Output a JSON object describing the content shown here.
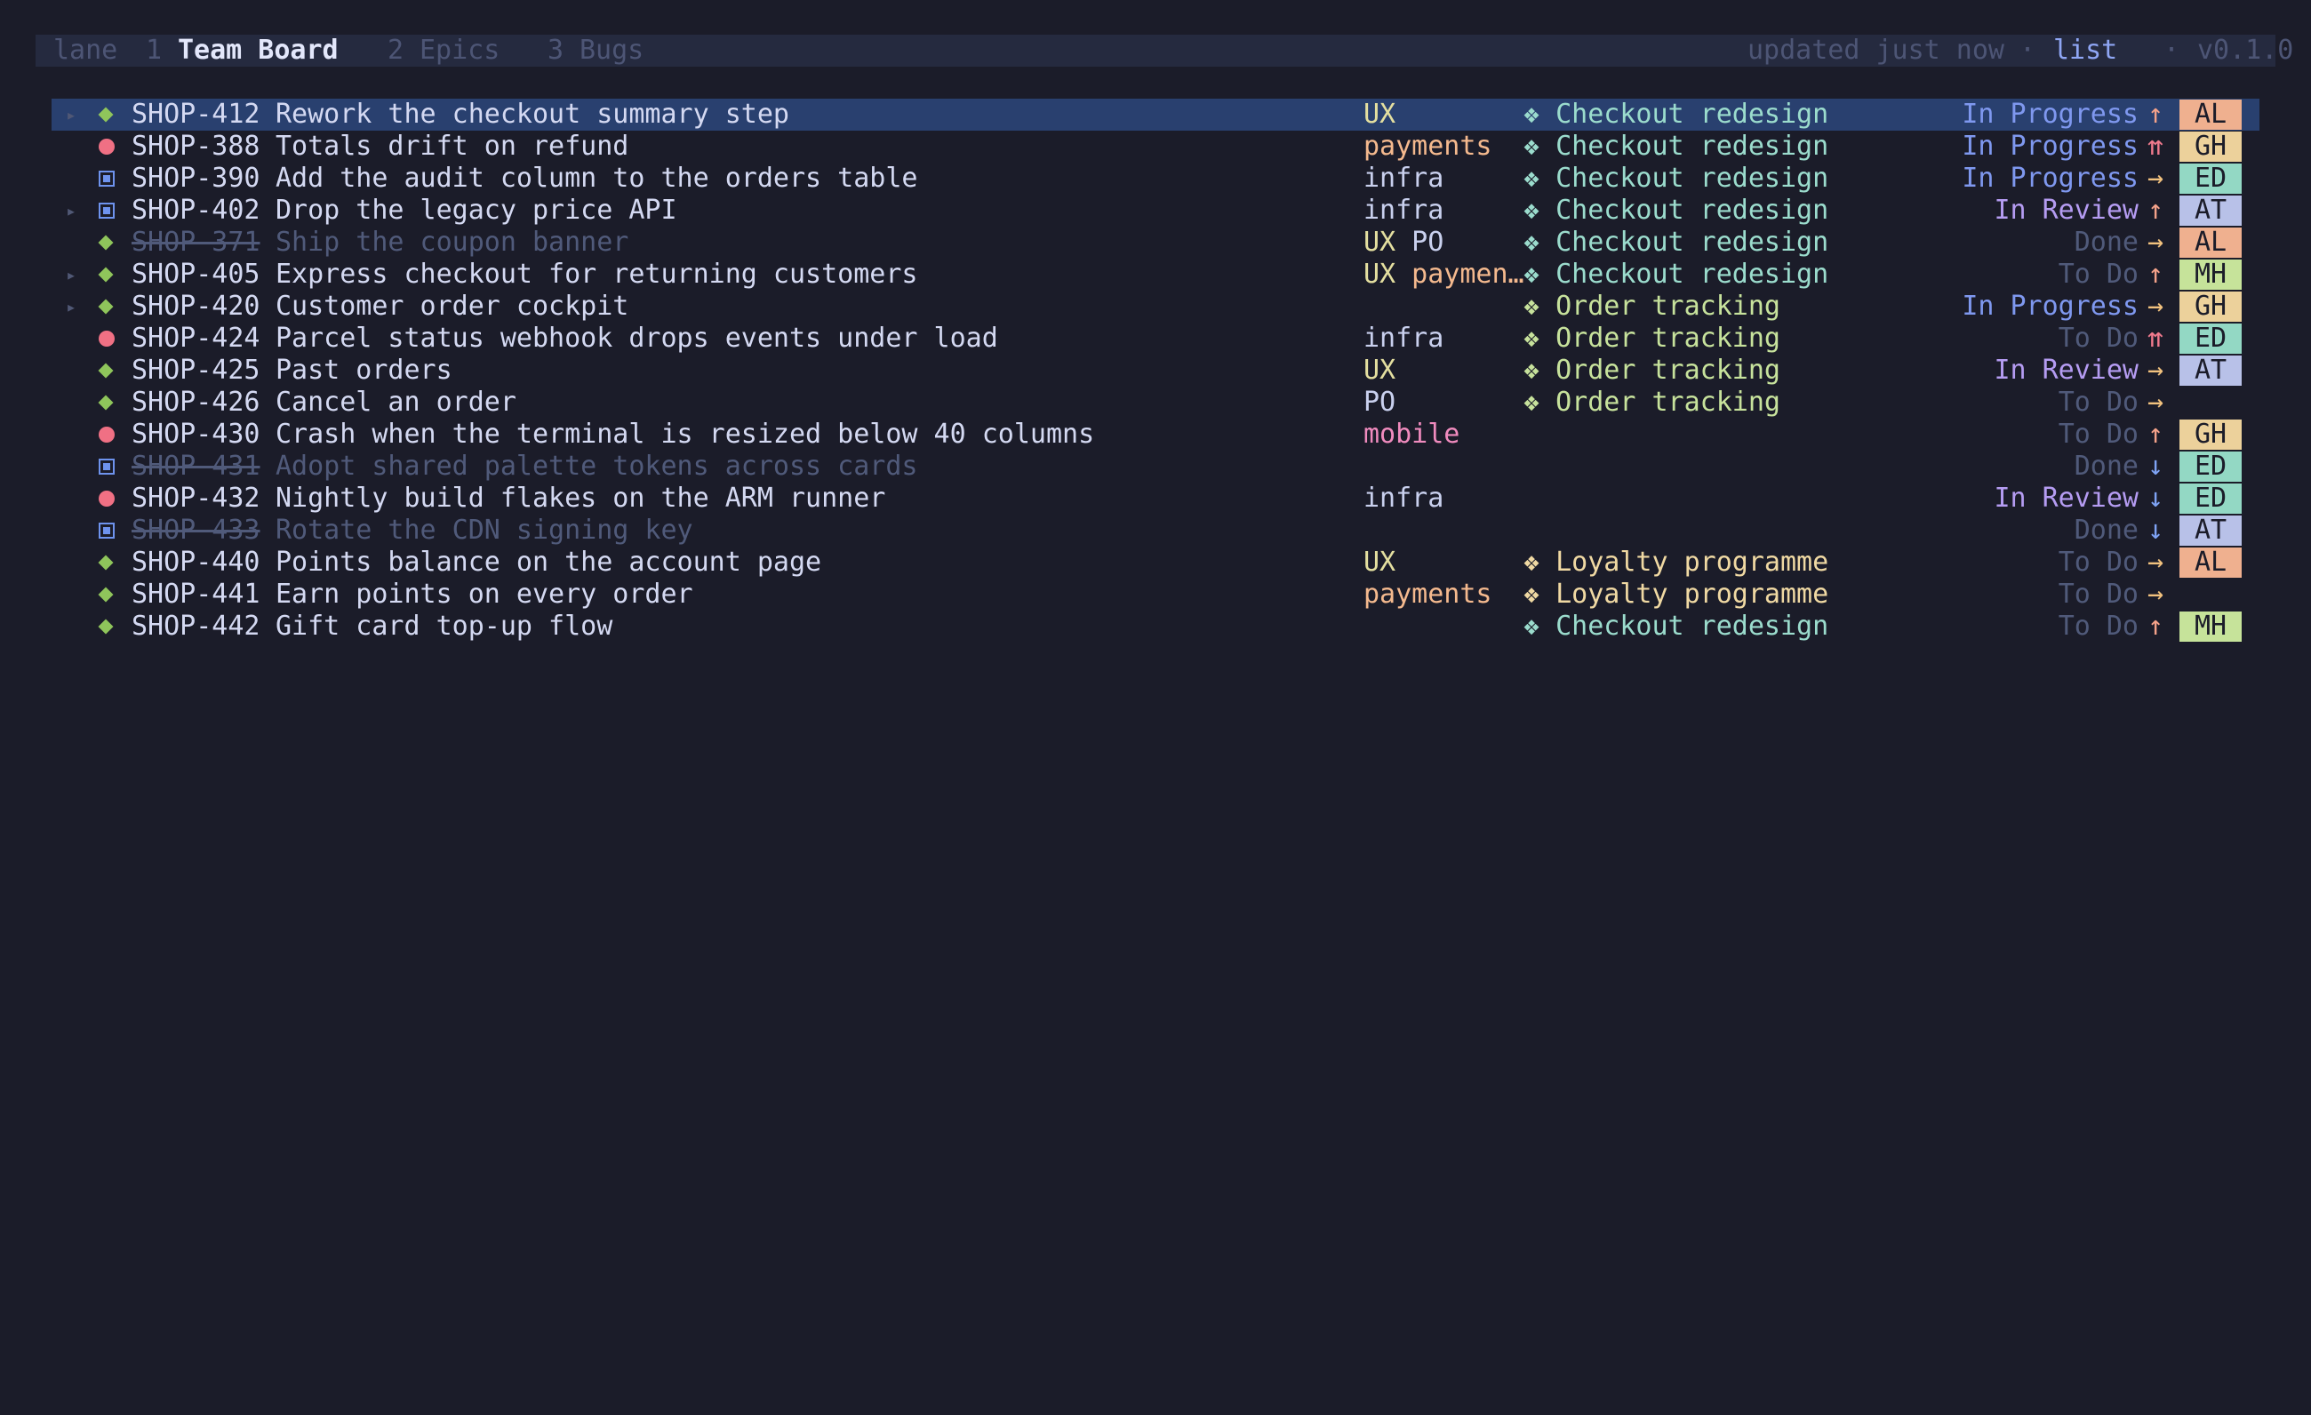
{
  "topbar": {
    "app_name": "lane",
    "tabs": [
      {
        "num": "1",
        "label": "Team Board",
        "active": true
      },
      {
        "num": "2",
        "label": "Epics",
        "active": false
      },
      {
        "num": "3",
        "label": "Bugs",
        "active": false
      }
    ],
    "updated": "updated just now",
    "sep1": "·",
    "view_mode": "list",
    "sep2": "·",
    "version": "v0.1.0"
  },
  "colors": {
    "background": "#1b1c29",
    "selected_row": "#29406f",
    "avatar_AL": "#efb08f",
    "avatar_GH": "#ecd19b",
    "avatar_ED": "#93d8c4",
    "avatar_AT": "#b8c1e8",
    "avatar_MH": "#c6e39a"
  },
  "rows": [
    {
      "expander": "▸",
      "type": "story",
      "type_icon": "story-diamond-icon",
      "key": "SHOP-412",
      "title": "Rework the checkout summary step",
      "labels": [
        {
          "text": "UX",
          "kind": "UX"
        }
      ],
      "epic_glyph": "❖",
      "epic": "Checkout redesign",
      "epic_color": "teal",
      "status": "In Progress",
      "status_kind": "progress",
      "priority": "↑",
      "priority_kind": "high",
      "assignee": "AL",
      "selected": true,
      "done": false
    },
    {
      "expander": "",
      "type": "bug",
      "type_icon": "bug-dot-icon",
      "key": "SHOP-388",
      "title": "Totals drift on refund",
      "labels": [
        {
          "text": "payments",
          "kind": "payments"
        }
      ],
      "epic_glyph": "❖",
      "epic": "Checkout redesign",
      "epic_color": "teal",
      "status": "In Progress",
      "status_kind": "progress",
      "priority": "⇈",
      "priority_kind": "highest",
      "assignee": "GH",
      "selected": false,
      "done": false
    },
    {
      "expander": "",
      "type": "task",
      "type_icon": "task-square-icon",
      "key": "SHOP-390",
      "title": "Add the audit column to the orders table",
      "labels": [
        {
          "text": "infra",
          "kind": "infra"
        }
      ],
      "epic_glyph": "❖",
      "epic": "Checkout redesign",
      "epic_color": "teal",
      "status": "In Progress",
      "status_kind": "progress",
      "priority": "→",
      "priority_kind": "medium",
      "assignee": "ED",
      "selected": false,
      "done": false
    },
    {
      "expander": "▸",
      "type": "task",
      "type_icon": "task-square-icon",
      "key": "SHOP-402",
      "title": "Drop the legacy price API",
      "labels": [
        {
          "text": "infra",
          "kind": "infra"
        }
      ],
      "epic_glyph": "❖",
      "epic": "Checkout redesign",
      "epic_color": "teal",
      "status": "In Review",
      "status_kind": "review",
      "priority": "↑",
      "priority_kind": "high",
      "assignee": "AT",
      "selected": false,
      "done": false
    },
    {
      "expander": "",
      "type": "story",
      "type_icon": "story-diamond-icon",
      "key": "SHOP-371",
      "title": "Ship the coupon banner",
      "labels": [
        {
          "text": "UX",
          "kind": "UX"
        },
        {
          "text": "PO",
          "kind": "PO"
        }
      ],
      "epic_glyph": "❖",
      "epic": "Checkout redesign",
      "epic_color": "teal",
      "status": "Done",
      "status_kind": "done",
      "priority": "→",
      "priority_kind": "medium",
      "assignee": "AL",
      "selected": false,
      "done": true
    },
    {
      "expander": "▸",
      "type": "story",
      "type_icon": "story-diamond-icon",
      "key": "SHOP-405",
      "title": "Express checkout for returning customers",
      "labels": [
        {
          "text": "UX",
          "kind": "UX"
        },
        {
          "text": "paymen…",
          "kind": "payments"
        }
      ],
      "epic_glyph": "❖",
      "epic": "Checkout redesign",
      "epic_color": "teal",
      "status": "To Do",
      "status_kind": "todo",
      "priority": "↑",
      "priority_kind": "high",
      "assignee": "MH",
      "selected": false,
      "done": false
    },
    {
      "expander": "▸",
      "type": "story",
      "type_icon": "story-diamond-icon",
      "key": "SHOP-420",
      "title": "Customer order cockpit",
      "labels": [],
      "epic_glyph": "❖",
      "epic": "Order tracking",
      "epic_color": "green",
      "status": "In Progress",
      "status_kind": "progress",
      "priority": "→",
      "priority_kind": "medium",
      "assignee": "GH",
      "selected": false,
      "done": false
    },
    {
      "expander": "",
      "type": "bug",
      "type_icon": "bug-dot-icon",
      "key": "SHOP-424",
      "title": "Parcel status webhook drops events under load",
      "labels": [
        {
          "text": "infra",
          "kind": "infra"
        }
      ],
      "epic_glyph": "❖",
      "epic": "Order tracking",
      "epic_color": "green",
      "status": "To Do",
      "status_kind": "todo",
      "priority": "⇈",
      "priority_kind": "highest",
      "assignee": "ED",
      "selected": false,
      "done": false
    },
    {
      "expander": "",
      "type": "story",
      "type_icon": "story-diamond-icon",
      "key": "SHOP-425",
      "title": "Past orders",
      "labels": [
        {
          "text": "UX",
          "kind": "UX"
        }
      ],
      "epic_glyph": "❖",
      "epic": "Order tracking",
      "epic_color": "green",
      "status": "In Review",
      "status_kind": "review",
      "priority": "→",
      "priority_kind": "medium",
      "assignee": "AT",
      "selected": false,
      "done": false
    },
    {
      "expander": "",
      "type": "story",
      "type_icon": "story-diamond-icon",
      "key": "SHOP-426",
      "title": "Cancel an order",
      "labels": [
        {
          "text": "PO",
          "kind": "PO"
        }
      ],
      "epic_glyph": "❖",
      "epic": "Order tracking",
      "epic_color": "green",
      "status": "To Do",
      "status_kind": "todo",
      "priority": "→",
      "priority_kind": "medium",
      "assignee": "",
      "selected": false,
      "done": false
    },
    {
      "expander": "",
      "type": "bug",
      "type_icon": "bug-dot-icon",
      "key": "SHOP-430",
      "title": "Crash when the terminal is resized below 40 columns",
      "labels": [
        {
          "text": "mobile",
          "kind": "mobile"
        }
      ],
      "epic_glyph": "",
      "epic": "",
      "epic_color": "teal",
      "status": "To Do",
      "status_kind": "todo",
      "priority": "↑",
      "priority_kind": "high",
      "assignee": "GH",
      "selected": false,
      "done": false
    },
    {
      "expander": "",
      "type": "task",
      "type_icon": "task-square-icon",
      "key": "SHOP-431",
      "title": "Adopt shared palette tokens across cards",
      "labels": [],
      "epic_glyph": "",
      "epic": "",
      "epic_color": "teal",
      "status": "Done",
      "status_kind": "done",
      "priority": "↓",
      "priority_kind": "low",
      "assignee": "ED",
      "selected": false,
      "done": true
    },
    {
      "expander": "",
      "type": "bug",
      "type_icon": "bug-dot-icon",
      "key": "SHOP-432",
      "title": "Nightly build flakes on the ARM runner",
      "labels": [
        {
          "text": "infra",
          "kind": "infra"
        }
      ],
      "epic_glyph": "",
      "epic": "",
      "epic_color": "teal",
      "status": "In Review",
      "status_kind": "review",
      "priority": "↓",
      "priority_kind": "low",
      "assignee": "ED",
      "selected": false,
      "done": false
    },
    {
      "expander": "",
      "type": "task",
      "type_icon": "task-square-icon",
      "key": "SHOP-433",
      "title": "Rotate the CDN signing key",
      "labels": [],
      "epic_glyph": "",
      "epic": "",
      "epic_color": "teal",
      "status": "Done",
      "status_kind": "done",
      "priority": "↓",
      "priority_kind": "low",
      "assignee": "AT",
      "selected": false,
      "done": true
    },
    {
      "expander": "",
      "type": "story",
      "type_icon": "story-diamond-icon",
      "key": "SHOP-440",
      "title": "Points balance on the account page",
      "labels": [
        {
          "text": "UX",
          "kind": "UX"
        }
      ],
      "epic_glyph": "❖",
      "epic": "Loyalty programme",
      "epic_color": "gold",
      "status": "To Do",
      "status_kind": "todo",
      "priority": "→",
      "priority_kind": "medium",
      "assignee": "AL",
      "selected": false,
      "done": false
    },
    {
      "expander": "",
      "type": "story",
      "type_icon": "story-diamond-icon",
      "key": "SHOP-441",
      "title": "Earn points on every order",
      "labels": [
        {
          "text": "payments",
          "kind": "payments"
        }
      ],
      "epic_glyph": "❖",
      "epic": "Loyalty programme",
      "epic_color": "gold",
      "status": "To Do",
      "status_kind": "todo",
      "priority": "→",
      "priority_kind": "medium",
      "assignee": "",
      "selected": false,
      "done": false
    },
    {
      "expander": "",
      "type": "story",
      "type_icon": "story-diamond-icon",
      "key": "SHOP-442",
      "title": "Gift card top-up flow",
      "labels": [],
      "epic_glyph": "❖",
      "epic": "Checkout redesign",
      "epic_color": "teal",
      "status": "To Do",
      "status_kind": "todo",
      "priority": "↑",
      "priority_kind": "high",
      "assignee": "MH",
      "selected": false,
      "done": false
    }
  ]
}
